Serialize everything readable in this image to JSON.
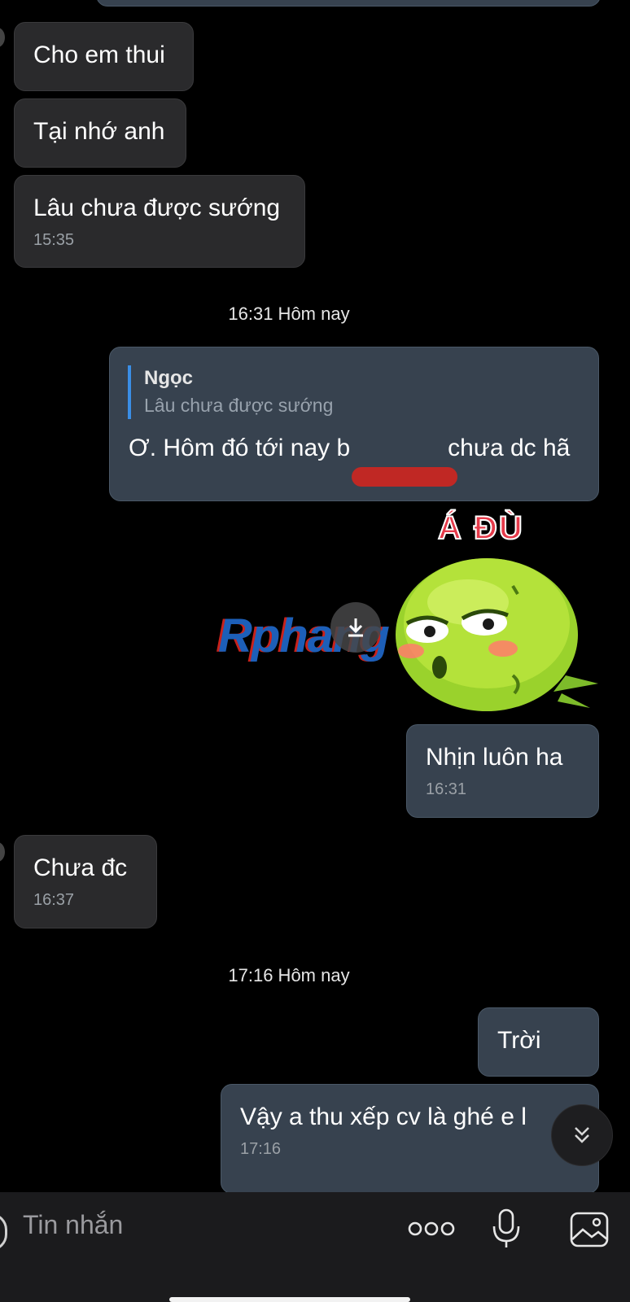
{
  "messages": {
    "m1": {
      "text": "Cho em thui"
    },
    "m2": {
      "text": "Tại nhớ anh"
    },
    "m3": {
      "text": "Lâu chưa được sướng",
      "time": "15:35"
    },
    "m4": {
      "quote_name": "Ngọc",
      "quote_text": "Lâu chưa được sướng",
      "text_before": "Ơ. Hôm đó tới nay b",
      "text_after": "chưa dc hã"
    },
    "m5": {
      "text": "Nhịn luôn ha",
      "time": "16:31"
    },
    "m6": {
      "text": "Chưa đc",
      "time": "16:37"
    },
    "m7": {
      "text": "Trời"
    },
    "m8": {
      "text": "Vậy a thu xếp cv là ghé e l",
      "time": "17:16"
    }
  },
  "dividers": {
    "d1": "16:31 Hôm nay",
    "d2": "17:16 Hôm nay"
  },
  "sticker": {
    "caption": "Á ĐÙ",
    "icon": "green-puffer-creature-sticker"
  },
  "watermark": {
    "text": "Rphang"
  },
  "composer": {
    "placeholder": "Tin nhắn",
    "icons": [
      "more-options-icon",
      "microphone-icon",
      "image-gallery-icon"
    ]
  },
  "colors": {
    "incoming_bubble": "#2a2a2c",
    "outgoing_bubble": "#37424f",
    "quote_bar": "#3a8ee6",
    "background": "#000000"
  }
}
